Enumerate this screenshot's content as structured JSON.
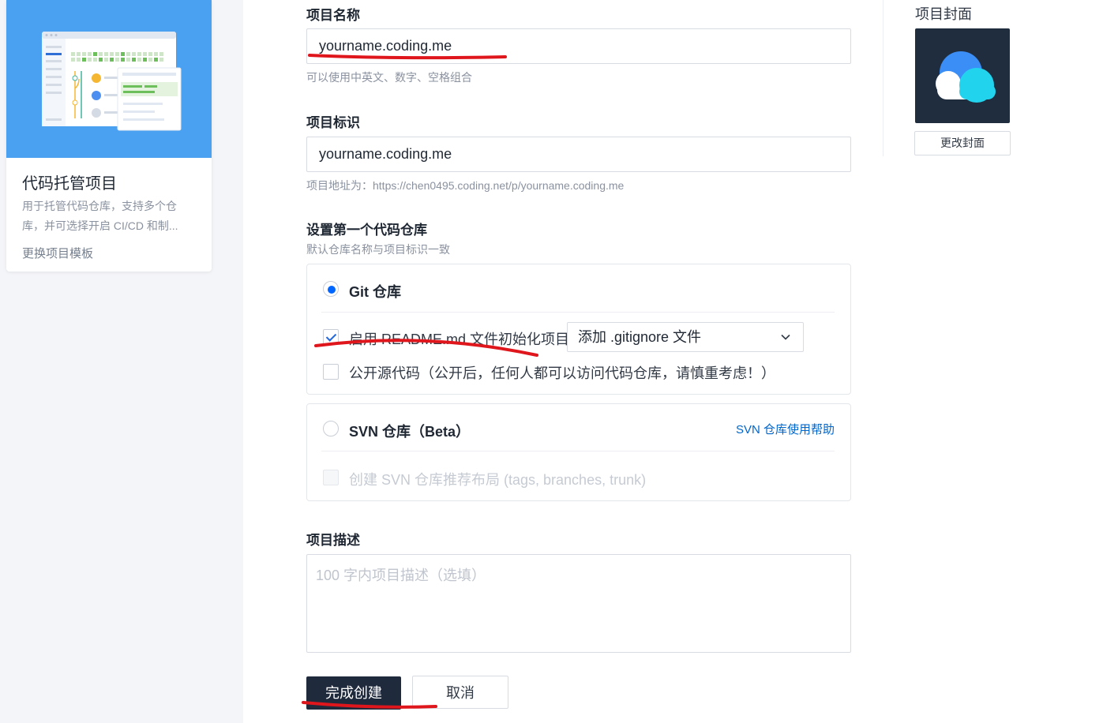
{
  "template": {
    "title": "代码托管项目",
    "description": "用于托管代码仓库，支持多个仓库，并可选择开启 CI/CD 和制...",
    "change_label": "更换项目模板"
  },
  "form": {
    "name_label": "项目名称",
    "name_value": "yourname.coding.me",
    "name_hint": "可以使用中英文、数字、空格组合",
    "id_label": "项目标识",
    "id_value": "yourname.coding.me",
    "id_hint": "项目地址为：https://chen0495.coding.net/p/yourname.coding.me",
    "repo_label": "设置第一个代码仓库",
    "repo_hint": "默认仓库名称与项目标识一致",
    "git": {
      "name": "Git 仓库",
      "selected": true,
      "readme_label": "启用 README.md 文件初始化项目",
      "readme_checked": true,
      "gitignore_select": "添加 .gitignore 文件",
      "open_source_label": "公开源代码（公开后，任何人都可以访问代码仓库，请慎重考虑！）",
      "open_source_checked": false
    },
    "svn": {
      "name": "SVN 仓库（Beta）",
      "selected": false,
      "help_link": "SVN 仓库使用帮助",
      "layout_label": "创建 SVN 仓库推荐布局 (tags, branches, trunk)"
    },
    "desc_label": "项目描述",
    "desc_placeholder": "100 字内项目描述（选填）",
    "submit_label": "完成创建",
    "cancel_label": "取消"
  },
  "cover": {
    "label": "项目封面",
    "change_label": "更改封面"
  },
  "colors": {
    "primary": "#1f2a3d",
    "link": "#0066cc",
    "radio_active": "#0066ff",
    "annotation": "#e0161d"
  }
}
